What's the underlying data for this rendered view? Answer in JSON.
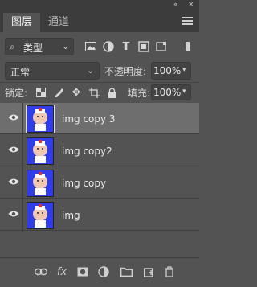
{
  "top": {
    "collapse_glyph": "«",
    "close_glyph": "×"
  },
  "tabs": [
    {
      "label": "图层",
      "active": true
    },
    {
      "label": "通道",
      "active": false
    }
  ],
  "filter": {
    "label": "类型",
    "icons": [
      "image-filter-icon",
      "adjustment-filter-icon",
      "type-filter-icon",
      "shape-filter-icon",
      "smart-object-filter-icon"
    ]
  },
  "blend": {
    "mode": "正常",
    "opacity_label": "不透明度:",
    "opacity": "100%"
  },
  "lock": {
    "label": "锁定:",
    "icons": [
      "lock-transparent-icon",
      "lock-paint-icon",
      "lock-position-icon",
      "lock-artboard-icon",
      "lock-all-icon"
    ]
  },
  "fill": {
    "label": "填充:",
    "value": "100%"
  },
  "layers": [
    {
      "name": "img copy 3",
      "selected": true
    },
    {
      "name": "img copy2",
      "selected": false
    },
    {
      "name": "img copy",
      "selected": false
    },
    {
      "name": "img",
      "selected": false
    }
  ],
  "bottom_icons": [
    "link-icon",
    "fx-icon",
    "mask-icon",
    "adjustment-icon",
    "group-folder-icon",
    "new-layer-icon",
    "trash-icon"
  ],
  "colors": {
    "panel_bg": "#535353",
    "header_bg": "#3c3c3c",
    "selected_row": "#6e6e6e",
    "thumb_bg": "#2f3ee6"
  }
}
